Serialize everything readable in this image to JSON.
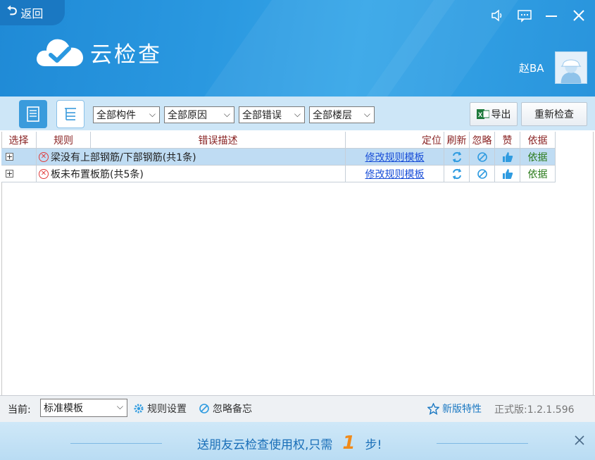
{
  "header": {
    "back_label": "返回",
    "app_title": "云检查",
    "username": "赵BA",
    "controls": [
      "speaker-icon",
      "message-icon",
      "minimize-icon",
      "close-icon"
    ]
  },
  "toolbar": {
    "filters": [
      "全部构件",
      "全部原因",
      "全部错误",
      "全部楼层"
    ],
    "export_label": "导出",
    "recheck_label": "重新检查"
  },
  "table": {
    "columns": [
      "选择",
      "规则",
      "错误描述",
      "定位",
      "刷新",
      "忽略",
      "赞",
      "依据"
    ],
    "rows": [
      {
        "expand": "+",
        "rule": "梁没有上部钢筋/下部钢筋(共1条)",
        "link": "修改规则模板",
        "basis": "依据"
      },
      {
        "expand": "+",
        "rule": "板未布置板筋(共5条)",
        "link": "修改规则模板",
        "basis": "依据"
      }
    ]
  },
  "status": {
    "current_label": "当前:",
    "template_value": "标准模板",
    "rule_settings": "规则设置",
    "ignore_notes": "忽略备忘",
    "new_features": "新版特性",
    "version": "正式版:1.2.1.596"
  },
  "banner": {
    "text_before": "送朋友云检查使用权,只需",
    "number": "1",
    "text_after": "步!"
  },
  "colors": {
    "header_blue": "#2a98e0",
    "selected_row": "#bfdcf3",
    "link": "#1a4fd8",
    "error_red": "#e03a3a",
    "basis_green": "#2a7a1a"
  }
}
